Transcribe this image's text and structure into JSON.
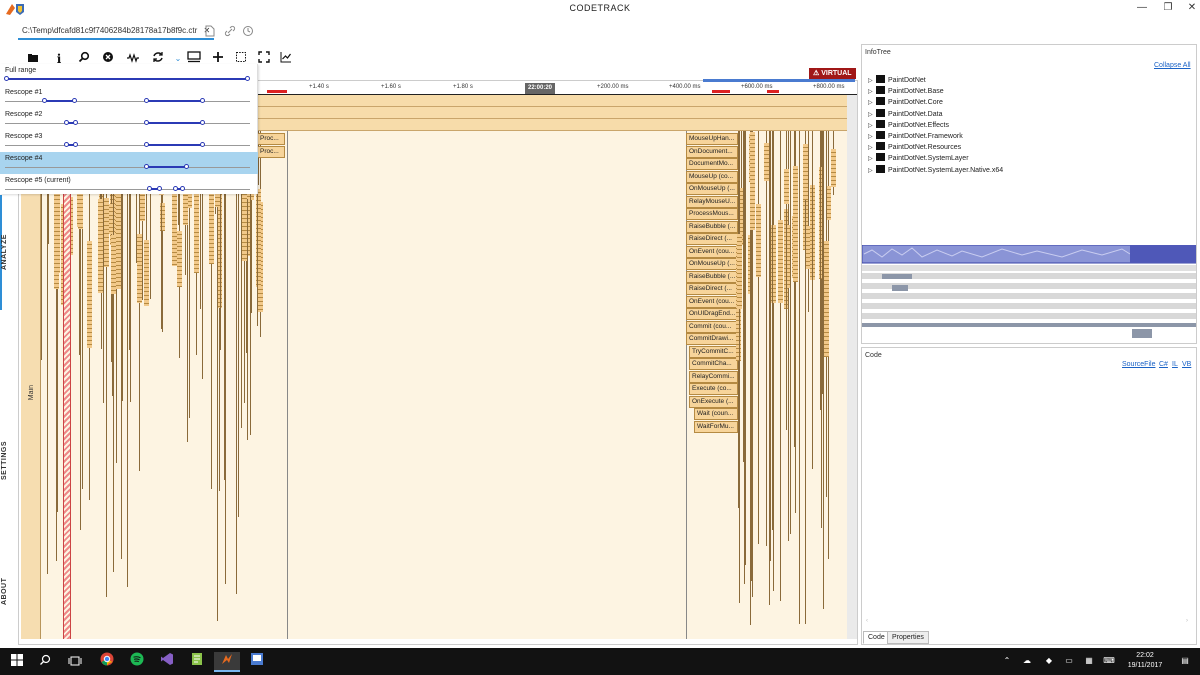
{
  "app": {
    "title": "CODETRACK",
    "window_buttons": {
      "minimize": "—",
      "restore": "❐",
      "close": "✕"
    }
  },
  "tab": {
    "label": "C:\\Temp\\dfcafd81c9f7406284b28178a17b8f9c.ctr",
    "close": "✕"
  },
  "left_nav": {
    "analyze": "ANALYZE",
    "settings": "SETTINGS",
    "about": "ABOUT"
  },
  "toolbar": {
    "icons": [
      "folder-icon",
      "info-icon",
      "search-icon",
      "stop-icon",
      "waveform-icon",
      "refresh-icon",
      "chevron-down-icon",
      "layout-icon",
      "add-icon",
      "select-icon",
      "fullscreen-icon",
      "chart-icon"
    ]
  },
  "rescope": {
    "items": [
      {
        "label": "Full range"
      },
      {
        "label": "Rescope #1"
      },
      {
        "label": "Rescope #2"
      },
      {
        "label": "Rescope #3"
      },
      {
        "label": "Rescope #4",
        "selected": true
      },
      {
        "label": "Rescope #5 (current)"
      }
    ]
  },
  "timeline": {
    "ticks": [
      "+1.40 s",
      "+1.60 s",
      "+1.80 s",
      "+200.00 ms",
      "+400.00 ms",
      "+600.00 ms",
      "+800.00 ms"
    ],
    "marker": "22:00:20",
    "badge": "VIRTUAL",
    "thread_label": "Main",
    "left_frames": [
      "Proc...",
      "Proc..."
    ],
    "frames": [
      "MouseUpHan...",
      "OnDocument...",
      "DocumentMo...",
      "MouseUp (co...",
      "OnMouseUp (...",
      "RelayMouseU...",
      "ProcessMous...",
      "RaiseBubble (...",
      "RaiseDirect (...",
      "OnEvent (cou...",
      "OnMouseUp (...",
      "RaiseBubble (...",
      "RaiseDirect (...",
      "OnEvent (cou...",
      "OnUIDragEnd...",
      "Commit (cou...",
      "CommitDrawi...",
      "TryCommitC...",
      "CommitCha...",
      "RelayCommi...",
      "Execute (co...",
      "OnExecute (...",
      "Wait (coun...",
      "WaitForMu..."
    ]
  },
  "infotree": {
    "title": "InfoTree",
    "collapse_all": "Collapse All",
    "items": [
      "PaintDotNet",
      "PaintDotNet.Base",
      "PaintDotNet.Core",
      "PaintDotNet.Data",
      "PaintDotNet.Effects",
      "PaintDotNet.Framework",
      "PaintDotNet.Resources",
      "PaintDotNet.SystemLayer",
      "PaintDotNet.SystemLayer.Native.x64"
    ]
  },
  "code": {
    "title": "Code",
    "links": [
      "SourceFile",
      "C#",
      "IL",
      "VB"
    ],
    "tabs": [
      "Code",
      "Properties"
    ]
  },
  "taskbar": {
    "apps": [
      "windows-icon",
      "search-icon",
      "task-view-icon",
      "chrome-icon",
      "spotify-icon",
      "visual-studio-icon",
      "notepad-icon",
      "codetrack-icon",
      "app-icon"
    ],
    "time": "22:02",
    "date": "19/11/2017"
  },
  "colors": {
    "accent": "#2e8ed6",
    "frame_fill": "#f7d49a",
    "frame_border": "#b58a42",
    "rescope_selected": "#a8d4ef",
    "virtual_badge": "#a01717"
  }
}
